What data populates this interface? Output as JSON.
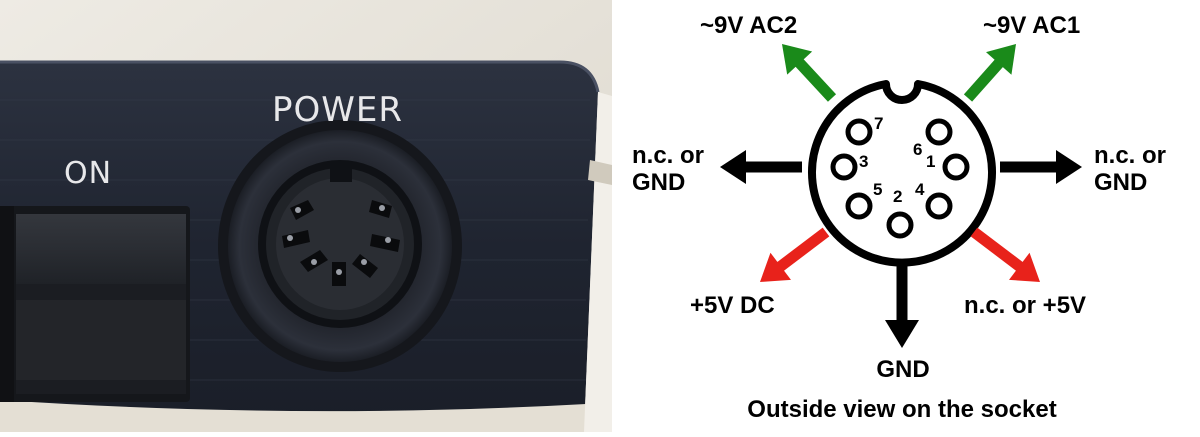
{
  "photo": {
    "power_label": "POWER",
    "on_label": "ON"
  },
  "diagram": {
    "labels": {
      "top_left": "~9V AC2",
      "top_right": "~9V AC1",
      "left_line1": "n.c. or",
      "left_line2": "GND",
      "right_line1": "n.c. or",
      "right_line2": "GND",
      "bottom_left": "+5V DC",
      "bottom_right": "n.c. or +5V",
      "bottom": "GND"
    },
    "pins": [
      "7",
      "6",
      "3",
      "1",
      "5",
      "4",
      "2"
    ],
    "caption": "Outside view on the socket",
    "colors": {
      "green": "#1a8a1a",
      "red": "#e8221b",
      "black": "#000000"
    }
  }
}
